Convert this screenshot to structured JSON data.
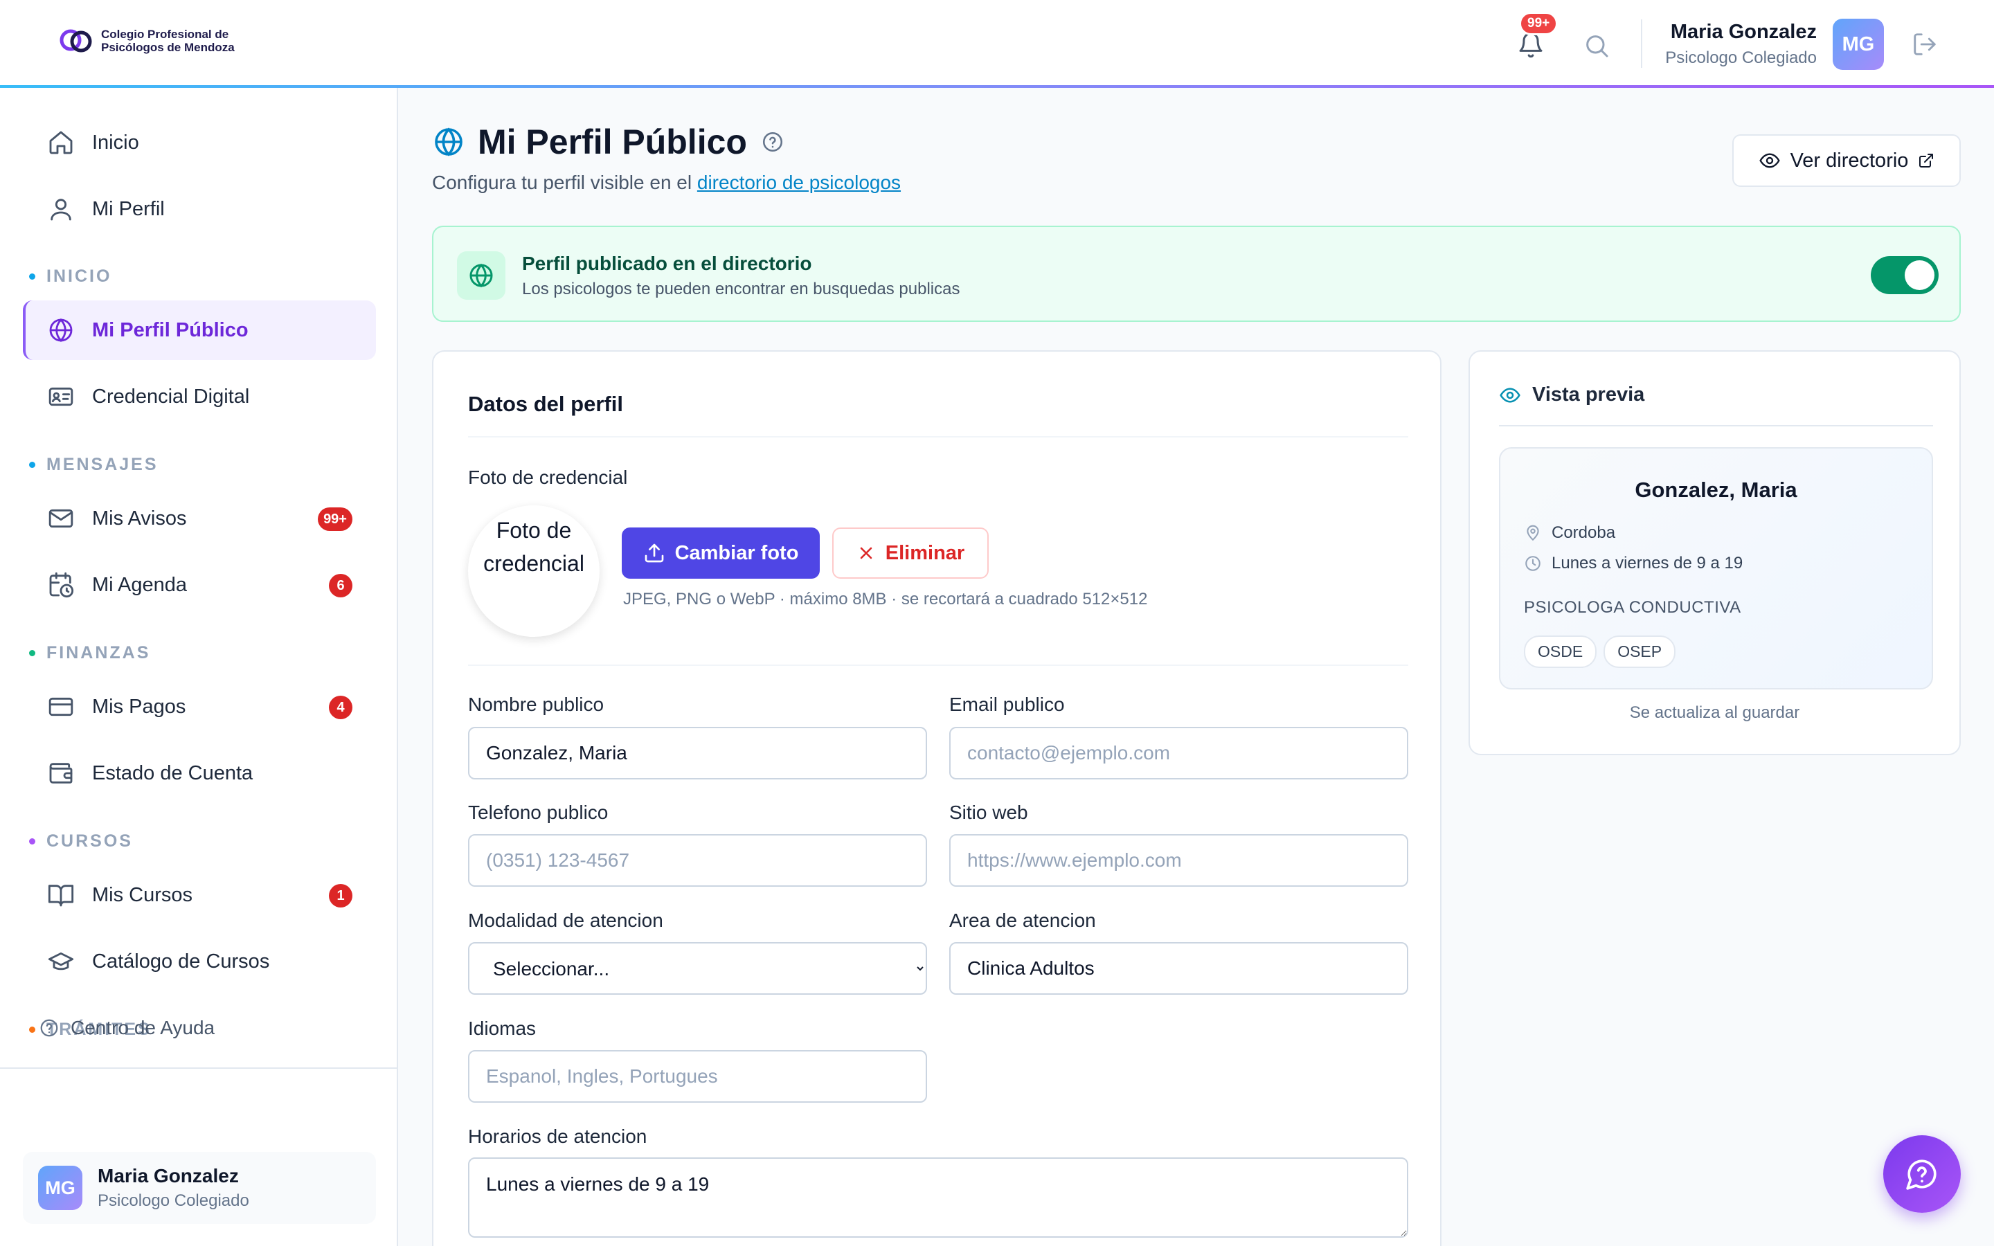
{
  "header": {
    "org_line1": "Colegio Profesional de",
    "org_line2": "Psicólogos de Mendoza",
    "notif_count": "99+",
    "user_name": "Maria Gonzalez",
    "user_role": "Psicologo Colegiado",
    "avatar_initials": "MG"
  },
  "sidebar": {
    "top_items": [
      {
        "label": "Inicio",
        "icon": "home-icon"
      },
      {
        "label": "Mi Perfil",
        "icon": "user-icon"
      }
    ],
    "sections": [
      {
        "label": "INICIO",
        "dot_color": "#0ea5e9"
      },
      {
        "label": "MENSAJES",
        "dot_color": "#0ea5e9"
      },
      {
        "label": "FINANZAS",
        "dot_color": "#10b981"
      },
      {
        "label": "CURSOS",
        "dot_color": "#a855f7"
      },
      {
        "label": "TRÁMITES",
        "dot_color": "#f97316"
      }
    ],
    "items": {
      "perfil_publico": "Mi Perfil Público",
      "credencial": "Credencial Digital",
      "avisos": "Mis Avisos",
      "avisos_badge": "99+",
      "agenda": "Mi Agenda",
      "agenda_badge": "6",
      "pagos": "Mis Pagos",
      "pagos_badge": "4",
      "estado_cuenta": "Estado de Cuenta",
      "cursos": "Mis Cursos",
      "cursos_badge": "1",
      "catalogo": "Catálogo de Cursos"
    },
    "help": "Centro de Ayuda",
    "user_card": {
      "name": "Maria Gonzalez",
      "role": "Psicologo Colegiado",
      "initials": "MG"
    }
  },
  "page": {
    "title": "Mi Perfil Público",
    "subtitle_prefix": "Configura tu perfil visible en el",
    "subtitle_link": "directorio de psicologos",
    "ver_directorio": "Ver directorio"
  },
  "banner": {
    "title": "Perfil publicado en el directorio",
    "desc": "Los psicologos te pueden encontrar en busquedas publicas",
    "published": true
  },
  "form": {
    "title": "Datos del perfil",
    "photo_label": "Foto de credencial",
    "photo_alt": "Foto de credencial",
    "change_photo": "Cambiar foto",
    "delete_photo": "Eliminar",
    "photo_hint": "JPEG, PNG o WebP · máximo 8MB · se recortará a cuadrado 512×512",
    "nombre_label": "Nombre publico",
    "nombre_value": "Gonzalez, Maria",
    "email_label": "Email publico",
    "email_placeholder": "contacto@ejemplo.com",
    "telefono_label": "Telefono publico",
    "telefono_placeholder": "(0351) 123-4567",
    "web_label": "Sitio web",
    "web_placeholder": "https://www.ejemplo.com",
    "modalidad_label": "Modalidad de atencion",
    "modalidad_value": "Seleccionar...",
    "area_label": "Area de atencion",
    "area_value": "Clinica Adultos",
    "idiomas_label": "Idiomas",
    "idiomas_placeholder": "Espanol, Ingles, Portugues",
    "horarios_label": "Horarios de atencion",
    "horarios_value": "Lunes a viernes de 9 a 19"
  },
  "preview": {
    "title": "Vista previa",
    "name": "Gonzalez, Maria",
    "location": "Cordoba",
    "schedule": "Lunes a viernes de 9 a 19",
    "specialty": "PSICOLOGA CONDUCTIVA",
    "insurers": [
      "OSDE",
      "OSEP"
    ],
    "note": "Se actualiza al guardar"
  },
  "colors": {
    "primary": "#4f46e5",
    "accent_purple": "#7c3aed",
    "success": "#059669",
    "danger": "#dc2626"
  }
}
